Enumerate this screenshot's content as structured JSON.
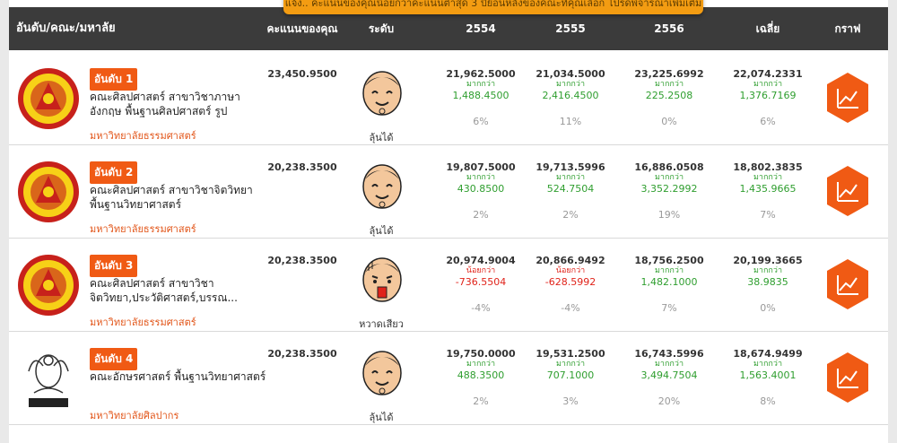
{
  "toast": "แจ้ง.. คะแนนของคุณน้อยกว่าคะแนนต่ำสุด 3 ปีย้อนหลังของคณะที่คุณเลือก โปรดพิจารณาเพิ่มเติม",
  "header": {
    "col_rank": "อันดับ/คณะ/มหาลัย",
    "col_score": "คะแนนของคุณ",
    "col_level": "ระดับ",
    "col_y1": "2554",
    "col_y2": "2555",
    "col_y3": "2556",
    "col_avg": "เฉลี่ย",
    "col_graph": "กราฟ"
  },
  "colors": {
    "accent": "#f05a14",
    "header": "#3b3b3b",
    "more": "#2f9e2f",
    "less": "#e0231a"
  },
  "rows": [
    {
      "rank": "อันดับ 1",
      "faculty": "คณะศิลปศาสตร์ สาขาวิชาภาษาอังกฤษ พื้นฐานศิลปศาสตร์ รูป",
      "university": "มหาวิทยาลัยธรรมศาสตร์",
      "logo": "thammasat-seal",
      "score": "23,450.9500",
      "face": "smile-face-icon",
      "level": "ลุ้นได้",
      "years": [
        {
          "value": "21,962.5000",
          "cmp": "มากกว่า",
          "diff": "1,488.4500",
          "pct": "6%"
        },
        {
          "value": "21,034.5000",
          "cmp": "มากกว่า",
          "diff": "2,416.4500",
          "pct": "11%"
        },
        {
          "value": "23,225.6992",
          "cmp": "มากกว่า",
          "diff": "225.2508",
          "pct": "0%"
        },
        {
          "value": "22,074.2331",
          "cmp": "มากกว่า",
          "diff": "1,376.7169",
          "pct": "6%"
        }
      ]
    },
    {
      "rank": "อันดับ 2",
      "faculty": "คณะศิลปศาสตร์ สาขาวิชาจิตวิทยา พื้นฐานวิทยาศาสตร์",
      "university": "มหาวิทยาลัยธรรมศาสตร์",
      "logo": "thammasat-seal",
      "score": "20,238.3500",
      "face": "smile-face-icon",
      "level": "ลุ้นได้",
      "years": [
        {
          "value": "19,807.5000",
          "cmp": "มากกว่า",
          "diff": "430.8500",
          "pct": "2%"
        },
        {
          "value": "19,713.5996",
          "cmp": "มากกว่า",
          "diff": "524.7504",
          "pct": "2%"
        },
        {
          "value": "16,886.0508",
          "cmp": "มากกว่า",
          "diff": "3,352.2992",
          "pct": "19%"
        },
        {
          "value": "18,802.3835",
          "cmp": "มากกว่า",
          "diff": "1,435.9665",
          "pct": "7%"
        }
      ]
    },
    {
      "rank": "อันดับ 3",
      "faculty": "คณะศิลปศาสตร์ สาขาวิชาจิตวิทยา,ประวัติศาสตร์,บรรณ...",
      "university": "มหาวิทยาลัยธรรมศาสตร์",
      "logo": "thammasat-seal",
      "score": "20,238.3500",
      "face": "worried-face-icon",
      "level": "หวาดเสียว",
      "years": [
        {
          "value": "20,974.9004",
          "cmp": "น้อยกว่า",
          "diff": "-736.5504",
          "pct": "-4%"
        },
        {
          "value": "20,866.9492",
          "cmp": "น้อยกว่า",
          "diff": "-628.5992",
          "pct": "-4%"
        },
        {
          "value": "18,756.2500",
          "cmp": "มากกว่า",
          "diff": "1,482.1000",
          "pct": "7%"
        },
        {
          "value": "20,199.3665",
          "cmp": "มากกว่า",
          "diff": "38.9835",
          "pct": "0%"
        }
      ]
    },
    {
      "rank": "อันดับ 4",
      "faculty": "คณะอักษรศาสตร์ พื้นฐานวิทยาศาสตร์",
      "university": "มหาวิทยาลัยศิลปากร",
      "logo": "silpakorn-seal",
      "score": "20,238.3500",
      "face": "smile-face-icon",
      "level": "ลุ้นได้",
      "years": [
        {
          "value": "19,750.0000",
          "cmp": "มากกว่า",
          "diff": "488.3500",
          "pct": "2%"
        },
        {
          "value": "19,531.2500",
          "cmp": "มากกว่า",
          "diff": "707.1000",
          "pct": "3%"
        },
        {
          "value": "16,743.5996",
          "cmp": "มากกว่า",
          "diff": "3,494.7504",
          "pct": "20%"
        },
        {
          "value": "18,674.9499",
          "cmp": "มากกว่า",
          "diff": "1,563.4001",
          "pct": "8%"
        }
      ]
    }
  ]
}
